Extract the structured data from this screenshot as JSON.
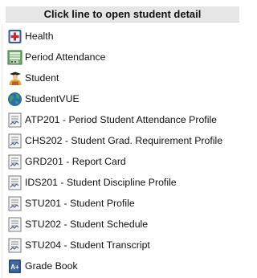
{
  "header": {
    "title": "Click line to open student detail"
  },
  "items": [
    {
      "label": "Health",
      "icon": "health-icon"
    },
    {
      "label": "Period Attendance",
      "icon": "attendance-icon"
    },
    {
      "label": "Student",
      "icon": "student-icon"
    },
    {
      "label": "StudentVUE",
      "icon": "globe-icon"
    },
    {
      "label": "ATP201 - Period Student Attendance Profile",
      "icon": "report-icon"
    },
    {
      "label": "CHS202 - Student Grad. Requirement Profile",
      "icon": "report-icon"
    },
    {
      "label": "GRD201 - Report Card",
      "icon": "report-icon"
    },
    {
      "label": "IDS201 - Student Discipline Profile",
      "icon": "report-icon"
    },
    {
      "label": "STU201 - Student Profile",
      "icon": "report-icon"
    },
    {
      "label": "STU202 - Student Schedule",
      "icon": "report-icon"
    },
    {
      "label": "STU204 - Student Transcript",
      "icon": "report-icon"
    },
    {
      "label": "Grade Book",
      "icon": "gradebook-icon"
    }
  ]
}
